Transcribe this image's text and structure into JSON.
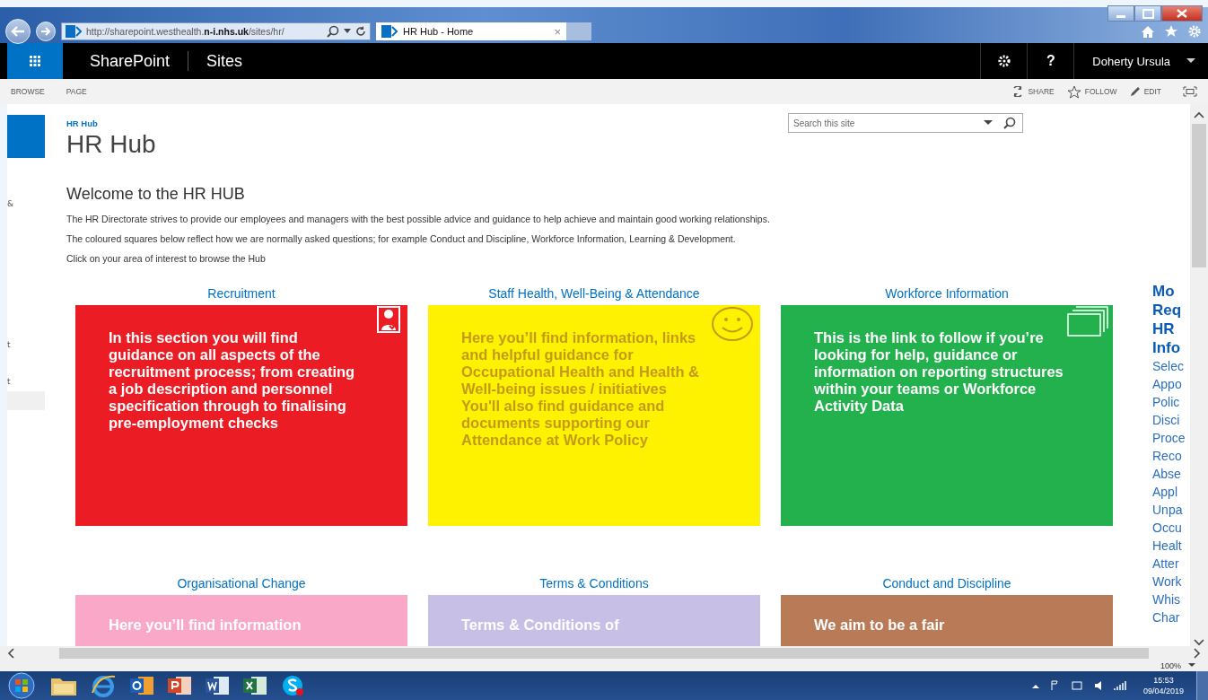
{
  "browser": {
    "address": "http://sharepoint.westhealth.**n-i.nhs.uk**/sites/hr/",
    "tab": {
      "title": "HR Hub - Home",
      "close": "×"
    }
  },
  "suite_bar": {
    "app": "SharePoint",
    "sites": "Sites",
    "help": "?",
    "user": "Doherty Ursula"
  },
  "ribbon": {
    "left": [
      "BROWSE",
      "PAGE"
    ],
    "right": [
      {
        "kind": "share",
        "label": "SHARE"
      },
      {
        "kind": "follow",
        "label": "FOLLOW"
      },
      {
        "kind": "edit",
        "label": "EDIT"
      }
    ]
  },
  "left_nav": [
    "&",
    "t",
    "t"
  ],
  "breadcrumb": "HR Hub",
  "title": "HR Hub",
  "search": {
    "placeholder": "Search this site"
  },
  "welcome": {
    "heading": "Welcome to the HR HUB",
    "paragraphs": [
      "The HR Directorate strives to provide our employees and  managers with the best possible advice and guidance to help achieve and maintain good working relationships.",
      "The coloured squares below reflect how we are normally asked questions; for example Conduct and Discipline, Workforce Information,  Learning & Development.",
      "Click on your area of interest to browse the Hub"
    ]
  },
  "tiles": [
    {
      "heading": "Recruitment",
      "color": "#ec1c24",
      "kind": "person",
      "paragraphs": [
        "In this section you will find guidance on all aspects of the recruitment process; from creating a job description and personnel specification through to finalising pre-employment checks"
      ]
    },
    {
      "heading": "Staff Health, Well-Being & Attendance",
      "color": "#fff200",
      "kind": "smiley",
      "paragraphs": [
        "Here you’ll find information, links and helpful guidance for Occupational Health and Health & Well-being issues / initiatives",
        "You'll also find guidance and documents supporting our Attendance at Work Policy"
      ]
    },
    {
      "heading": "Workforce Information",
      "color": "#22b14c",
      "kind": "pages",
      "paragraphs": [
        "This is the link to follow if you’re looking for help, guidance or information on reporting structures within your teams or Workforce Activity Data"
      ]
    },
    {
      "heading": "Organisational Change",
      "color": "#f9a8c8",
      "paragraphs": [
        "Here you’ll find information"
      ]
    },
    {
      "heading": "Terms & Conditions",
      "color": "#c8bfe7",
      "paragraphs": [
        "Terms & Conditions of"
      ]
    },
    {
      "heading": "Conduct and Discipline",
      "color": "#b97a57",
      "paragraphs": [
        "We aim to be a fair"
      ]
    }
  ],
  "most_requested": {
    "heading": [
      "Mo",
      "Req",
      "HR",
      "Info"
    ],
    "items": [
      "Selec",
      "Appo",
      "Polic",
      "Disci",
      "Proce",
      "Reco",
      "Abse",
      "Appl",
      "Unpa",
      "Occu",
      "Healt",
      "Atter",
      "Work",
      "Whis",
      "Char"
    ]
  },
  "status_bar": {
    "zoom": "100%"
  },
  "taskbar": {
    "time": "15:53",
    "date": "09/04/2019"
  }
}
